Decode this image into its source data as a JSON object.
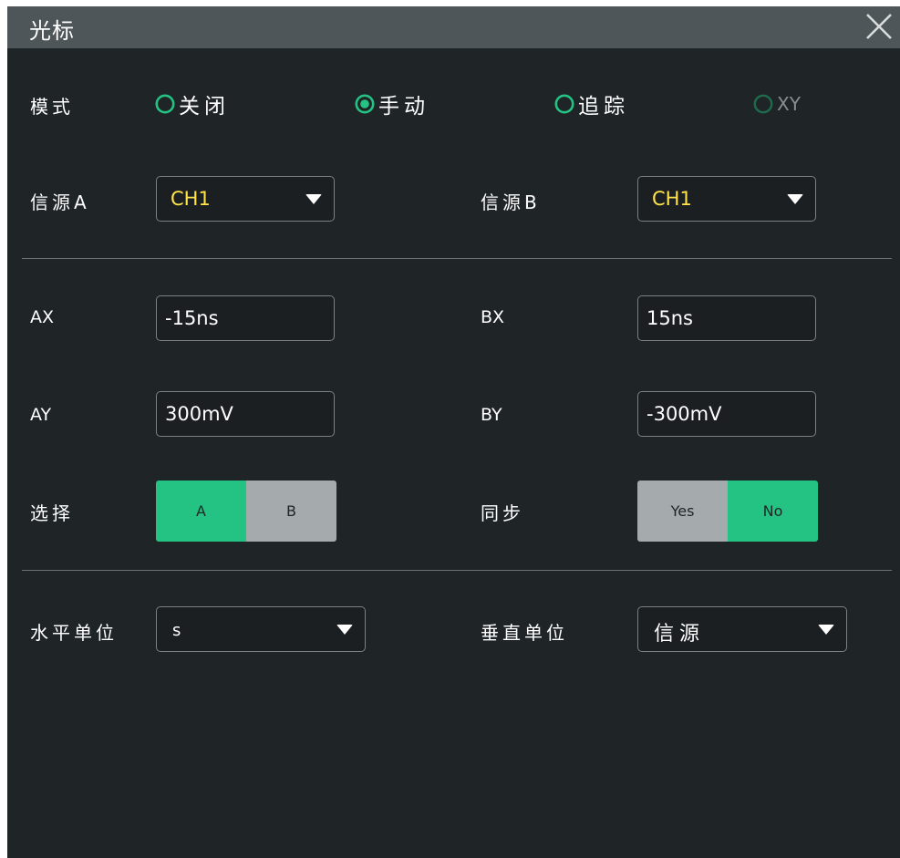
{
  "window": {
    "title": "光标",
    "close_icon": "close-icon"
  },
  "mode": {
    "label": "模式",
    "options": [
      {
        "label": "关闭",
        "selected": false,
        "enabled": true
      },
      {
        "label": "手动",
        "selected": true,
        "enabled": true
      },
      {
        "label": "追踪",
        "selected": false,
        "enabled": true
      },
      {
        "label": "XY",
        "selected": false,
        "enabled": false
      }
    ]
  },
  "sources": {
    "a": {
      "label": "信源A",
      "value": "CH1"
    },
    "b": {
      "label": "信源B",
      "value": "CH1"
    }
  },
  "cursors": {
    "ax": {
      "label": "AX",
      "value": "-15ns"
    },
    "bx": {
      "label": "BX",
      "value": "15ns"
    },
    "ay": {
      "label": "AY",
      "value": "300mV"
    },
    "by": {
      "label": "BY",
      "value": "-300mV"
    }
  },
  "select": {
    "label": "选择",
    "options": [
      "A",
      "B"
    ],
    "selected": "A"
  },
  "sync": {
    "label": "同步",
    "options": [
      "Yes",
      "No"
    ],
    "selected": "No"
  },
  "units": {
    "horizontal": {
      "label": "水平单位",
      "value": "s"
    },
    "vertical": {
      "label": "垂直单位",
      "value": "信源"
    }
  },
  "colors": {
    "accent_green": "#24c383",
    "channel_yellow": "#ffe34a",
    "background": "#1f2427",
    "titlebar": "#4f5659",
    "toggle_off": "#a5abad"
  }
}
